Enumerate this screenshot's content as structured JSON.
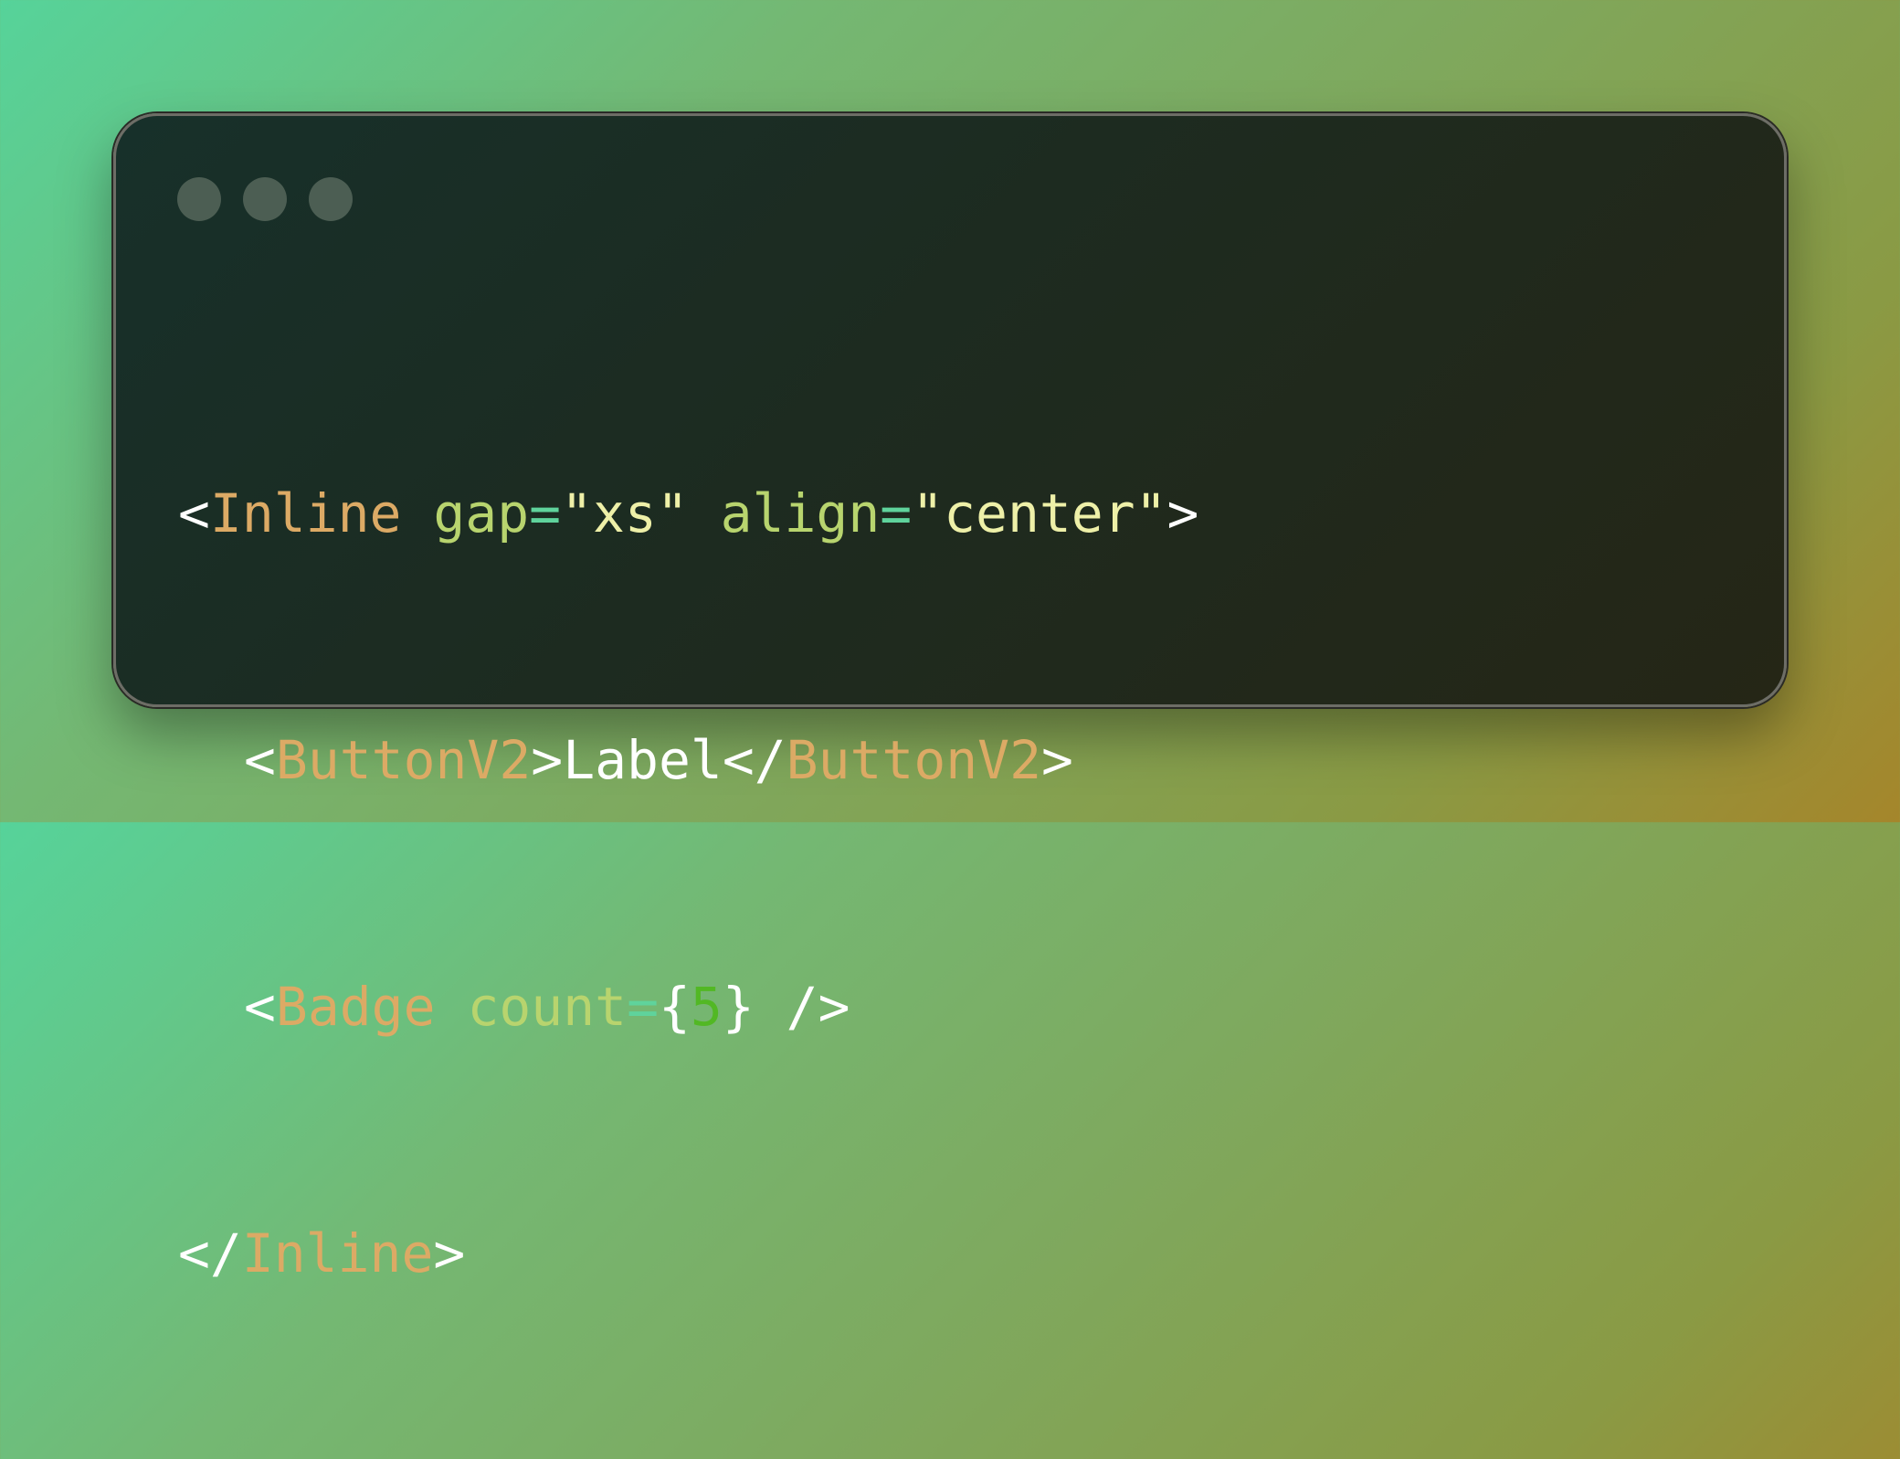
{
  "window": {
    "traffic_lights": [
      "close",
      "minimize",
      "maximize"
    ]
  },
  "code": {
    "line1": {
      "open": "<",
      "tag": "Inline",
      "attr1": "gap",
      "eq1": "=",
      "val1": "\"xs\"",
      "attr2": "align",
      "eq2": "=",
      "val2": "\"center\"",
      "close": ">"
    },
    "line2": {
      "open": "<",
      "tag": "ButtonV2",
      "close": ">",
      "text": "Label",
      "end_open": "</",
      "end_tag": "ButtonV2",
      "end_close": ">"
    },
    "line3": {
      "open": "<",
      "tag": "Badge",
      "attr": "count",
      "eq": "=",
      "brace_open": "{",
      "value": "5",
      "brace_close": "}",
      "self_close": " />"
    },
    "line4": {
      "open": "</",
      "tag": "Inline",
      "close": ">"
    }
  },
  "colors": {
    "tag": "#dcaa65",
    "attribute": "#b8d46e",
    "equals": "#5fd39c",
    "string": "#eef0a8",
    "number": "#52b824",
    "punctuation": "#ffffff"
  }
}
